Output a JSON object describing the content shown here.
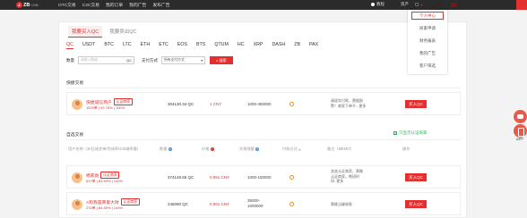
{
  "topbar": {
    "logo_text": "ZB",
    "logo_sub": "COM",
    "nav": [
      "OTC交易",
      "C2C交易",
      "我的订单",
      "我的广告",
      "发布广告"
    ],
    "tutorial": "教程",
    "asset": "资产"
  },
  "dropdown": {
    "items": [
      "个人中心",
      "商家申请",
      "财务报表",
      "我的广告",
      "客户筛选"
    ]
  },
  "tabs": [
    "我要买入QC",
    "我要卖出QC"
  ],
  "coins": [
    "QC",
    "USDT",
    "BTC",
    "LTC",
    "ETH",
    "ETC",
    "EOS",
    "BTS",
    "QTUM",
    "HC",
    "XRP",
    "DASH",
    "ZB",
    "PAX"
  ],
  "filters": {
    "qty_label": "数量",
    "qty_placeholder": "请输入数量",
    "qty_unit": "QC",
    "pay_label": "支付方式",
    "pay_value": "所有支付方式",
    "search": "搜索"
  },
  "quick": {
    "title": "快捷交易",
    "row": {
      "name": "快捷诚信商户",
      "badge": "认证商家",
      "stats": "1529单 | 92.76% | 100%",
      "qty": "304130.34 QC",
      "price": "1 CNY",
      "limit": "1000-350000",
      "memo": [
        "请说实付款，票据报",
        "警！商家下单不...更多"
      ],
      "button": "买入QC"
    }
  },
  "self": {
    "title": "自选交易",
    "verified_filter": "只显示认证商家",
    "headers": [
      "用户名称（30日成交单/完成率/24h确率量）",
      "数量",
      "价格",
      "交易限额",
      "付款方式",
      "备注（MEMO）",
      "操作"
    ],
    "rows": [
      {
        "name": "杨家勋",
        "badge": "认证商家",
        "stats": "637单 | 83.59% | 100%",
        "qty": "374149.55 QC",
        "price": "0.991 CNY",
        "limit": "1000-150000",
        "memo": [
          "卖卖认证商家，票稚",
          "认证商家，熊班时",
          "间..更多"
        ],
        "button": "买入QC"
      },
      {
        "name": "A和我是商家大财",
        "badge": "认证商家",
        "stats": "276单 | 84.65% | 100%",
        "qty": "246090 QC",
        "price": "0.991 CNY",
        "limit": [
          "35000-",
          "1000000"
        ],
        "memo": [
          "票稚当磋收款"
        ],
        "button": "买入QC"
      }
    ]
  },
  "widgets": {
    "app_label": "APP"
  },
  "colors": {
    "accent": "#e52e2e",
    "topbar": "#2b2b2b",
    "verified": "#3aab5f",
    "pay_icon": "#f08c1a"
  }
}
